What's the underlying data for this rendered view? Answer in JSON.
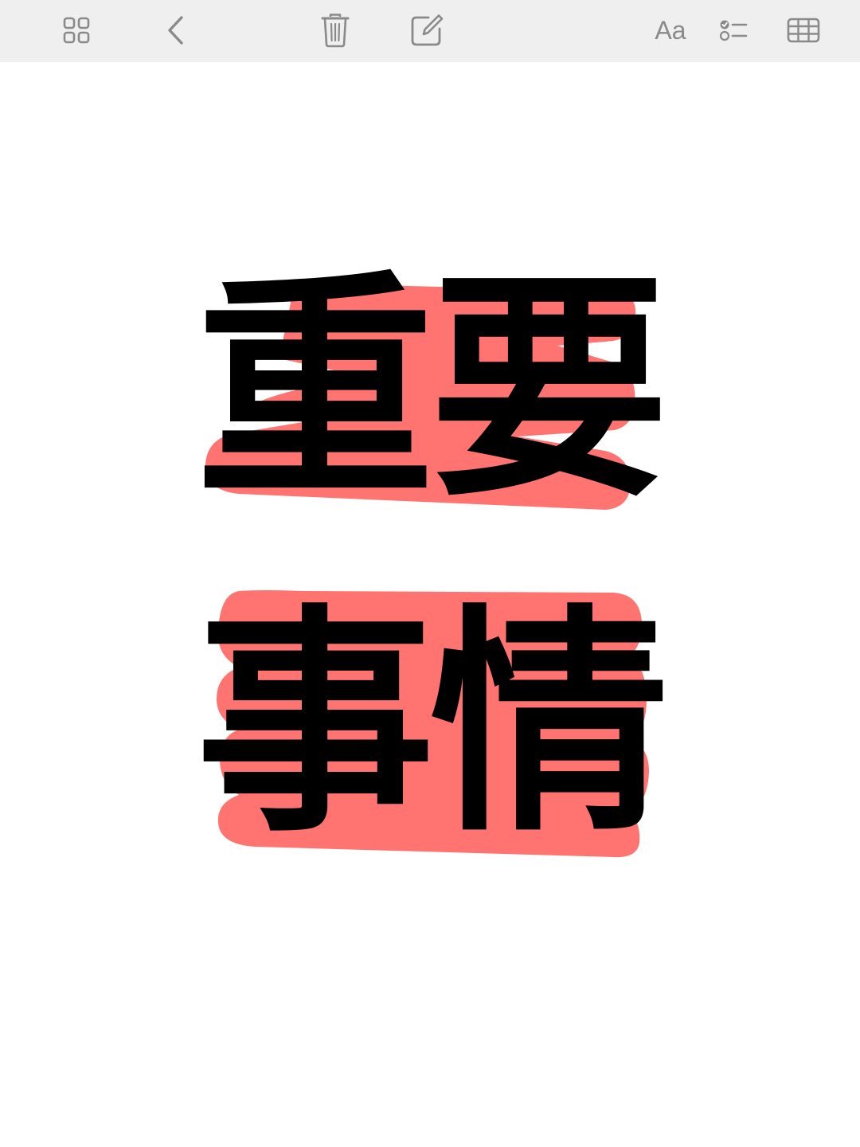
{
  "toolbar": {
    "buttons": [
      {
        "name": "gallery-view-button",
        "icon": "grid-icon"
      },
      {
        "name": "back-button",
        "icon": "chevron-left-icon"
      },
      {
        "name": "delete-button",
        "icon": "trash-icon"
      },
      {
        "name": "compose-button",
        "icon": "compose-icon"
      },
      {
        "name": "format-button",
        "icon": "text-format-icon",
        "label": "Aa"
      },
      {
        "name": "checklist-button",
        "icon": "checklist-icon"
      },
      {
        "name": "table-button",
        "icon": "table-icon"
      }
    ],
    "icon_color": "#8a8a8a",
    "background": "#efefef"
  },
  "note": {
    "line1": "重要",
    "line2": "事情",
    "text_color": "#000000",
    "highlight_color": "#ff7370"
  }
}
